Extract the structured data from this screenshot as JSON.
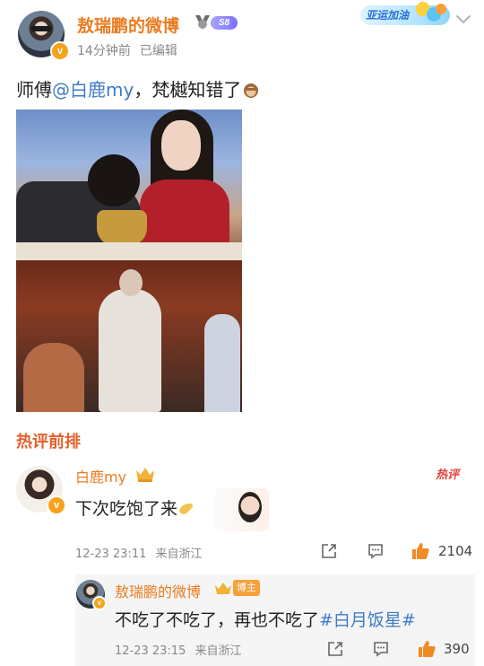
{
  "post": {
    "author": "敖瑞鹏的微博",
    "level_badge": "S8",
    "time": "14分钟前",
    "edited": "已编辑",
    "promo_banner": "亚运加油",
    "text_before": "师傅",
    "mention": "@白鹿my",
    "text_after": "，梵樾知错了"
  },
  "hot_comments": {
    "title": "热评前排",
    "hot_tag": "热评",
    "comment": {
      "author": "白鹿my",
      "text": "下次吃饱了来",
      "time": "12-23 23:11",
      "location": "来自浙江",
      "likes": "2104"
    },
    "reply": {
      "author": "敖瑞鹏的微博",
      "role_tag": "博主",
      "text": "不吃了不吃了，再也不吃了",
      "topic": "#白月饭星#",
      "time": "12-23 23:15",
      "location": "来自浙江",
      "likes": "390"
    }
  },
  "colors": {
    "accent_orange": "#eb7b1f",
    "link_blue": "#3f7bc8",
    "hot_red": "#e2612b",
    "like_orange": "#f08a24"
  },
  "icons": [
    "chevron-down-icon",
    "verified-v-icon",
    "medal-icon",
    "crown-icon",
    "share-icon",
    "comment-icon",
    "like-icon",
    "hand-emoji-icon",
    "monkey-emoji-icon"
  ]
}
